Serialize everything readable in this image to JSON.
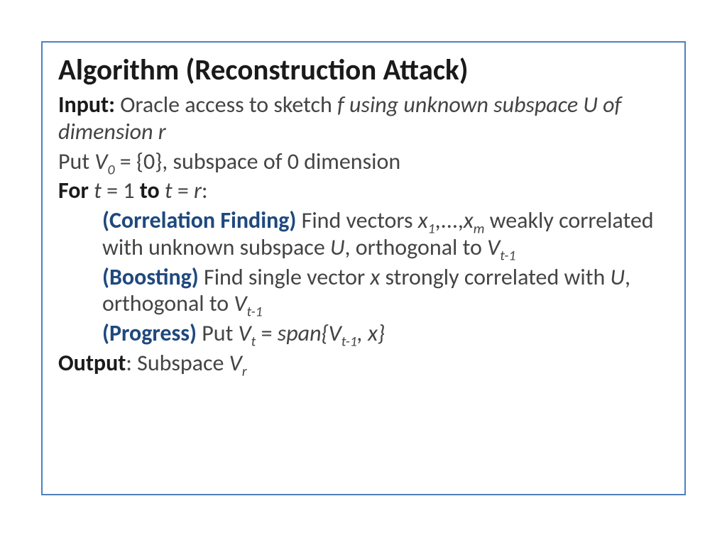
{
  "algorithm": {
    "title": "Algorithm (Reconstruction Attack)",
    "input_label": "Input:",
    "input_prefix": " Oracle access to sketch ",
    "input_italic": "f using unknown subspace U of dimension r",
    "init_prefix": "Put ",
    "init_var": "V",
    "init_sub": "0",
    "init_rest": " = {0}, subspace of 0 dimension",
    "for_label": "For",
    "for_t1": " t",
    "for_eq1": " = 1 ",
    "to_label": "to",
    "for_t2": " t",
    "for_eq2": " = ",
    "for_r": "r",
    "for_colon": ":",
    "corr_label": "(Correlation Finding)",
    "corr_text1": " Find vectors ",
    "corr_x1": "x",
    "corr_s1": "1",
    "corr_dots": ",...,",
    "corr_xm": "x",
    "corr_sm": "m",
    "corr_text2": " weakly correlated with unknown subspace ",
    "corr_U": "U",
    "corr_text3": ", orthogonal to ",
    "corr_V": "V",
    "corr_Vs": "t-1",
    "boost_label": "(Boosting)",
    "boost_text1": " Find single vector ",
    "boost_x": "x",
    "boost_text2": " strongly correlated with ",
    "boost_U": "U",
    "boost_text3": ", orthogonal to ",
    "boost_V": "V",
    "boost_Vs": "t-1",
    "prog_label": "(Progress)",
    "prog_text1": " Put ",
    "prog_Vt": "V",
    "prog_Vts": "t",
    "prog_eq": " = ",
    "prog_span1": "span{V",
    "prog_spans": "t-1",
    "prog_span2": ", x}",
    "output_label": "Output",
    "output_colon": ": Subspace ",
    "output_V": "V",
    "output_Vs": "r"
  }
}
